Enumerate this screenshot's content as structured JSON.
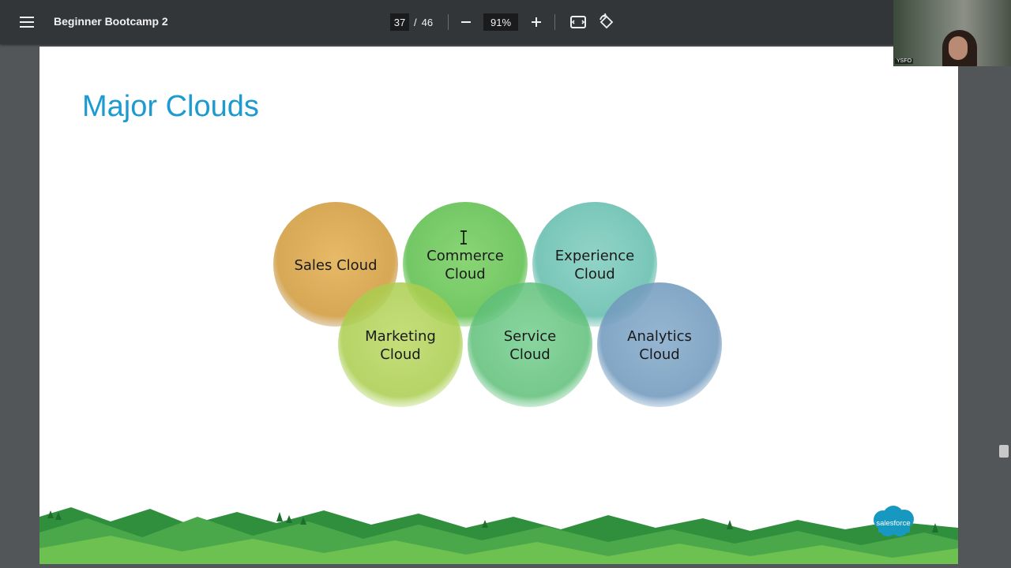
{
  "toolbar": {
    "title": "Beginner Bootcamp 2",
    "current_page": "37",
    "page_separator": "/",
    "total_pages": "46",
    "zoom": "91%"
  },
  "video": {
    "label": "YSFO"
  },
  "slide": {
    "title": "Major Clouds",
    "logo_text": "salesforce",
    "clouds": [
      {
        "line1": "Sales Cloud",
        "line2": ""
      },
      {
        "line1": "Commerce",
        "line2": "Cloud"
      },
      {
        "line1": "Experience",
        "line2": "Cloud"
      },
      {
        "line1": "Marketing",
        "line2": "Cloud"
      },
      {
        "line1": "Service",
        "line2": "Cloud"
      },
      {
        "line1": "Analytics",
        "line2": "Cloud"
      }
    ]
  },
  "colors": {
    "title_blue": "#1b9bd1",
    "sales": "#d8a850",
    "commerce": "#66c455",
    "experience": "#6cc3b4",
    "marketing": "#a9cc45",
    "service": "#5cc278",
    "analytics": "#6e9abf"
  }
}
